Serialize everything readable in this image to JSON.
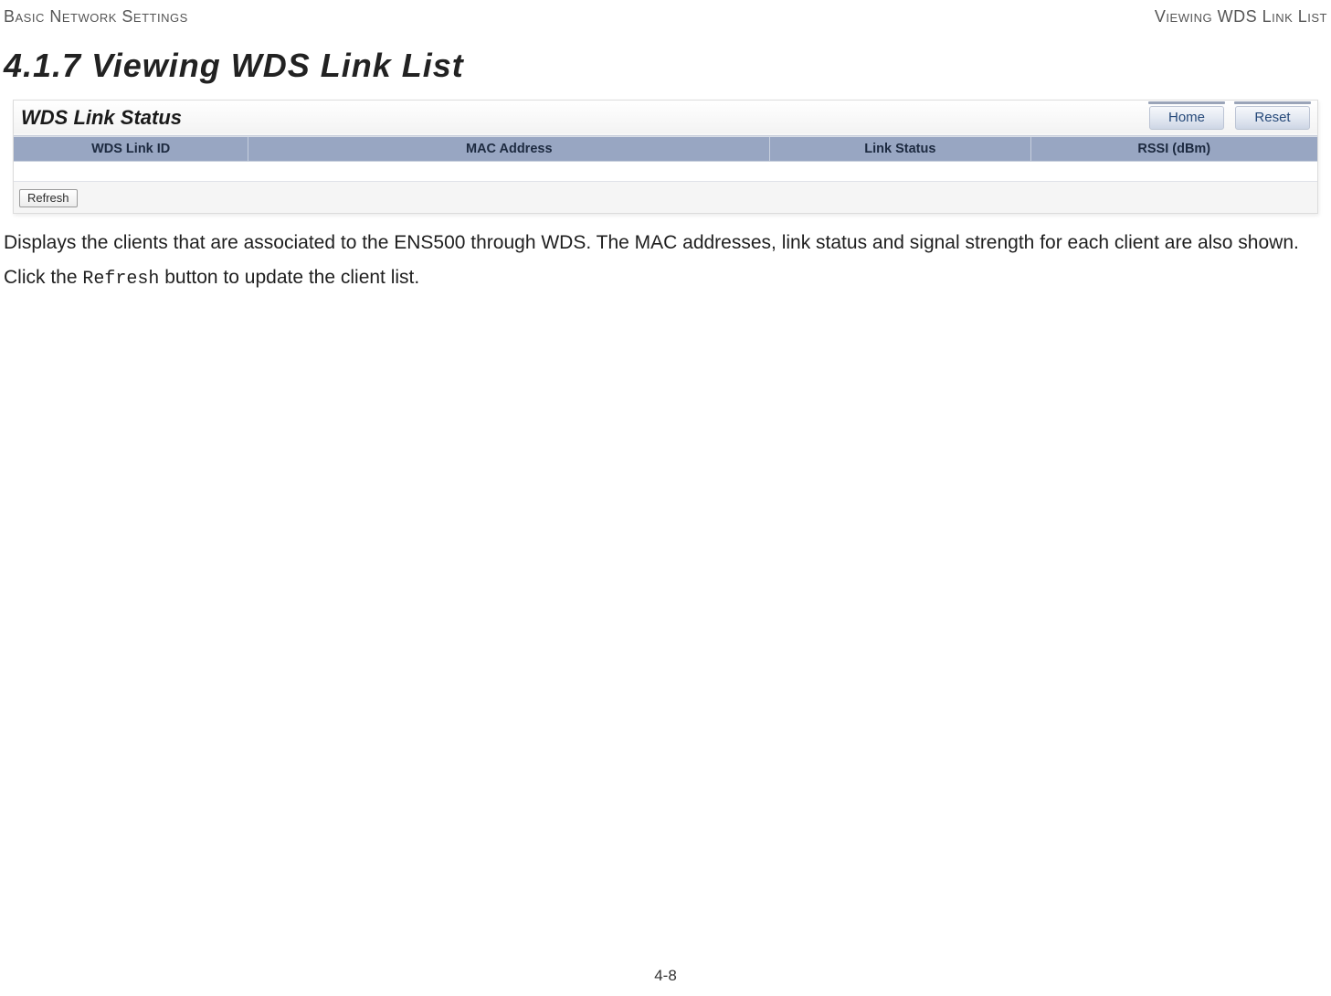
{
  "header": {
    "left": "Basic Network Settings",
    "right": "Viewing WDS Link List"
  },
  "section_title": "4.1.7 Viewing WDS Link List",
  "panel": {
    "title": "WDS Link Status",
    "buttons": {
      "home": "Home",
      "reset": "Reset"
    },
    "columns": {
      "wds_link_id": "WDS Link ID",
      "mac_address": "MAC Address",
      "link_status": "Link Status",
      "rssi": "RSSI (dBm)"
    },
    "refresh_label": "Refresh"
  },
  "description": {
    "para1": "Displays the clients that are associated to the ENS500 through WDS. The MAC addresses, link status and signal strength for each client are also shown.",
    "para2_prefix": "Click the ",
    "para2_code": "Refresh",
    "para2_suffix": " button to update the client list."
  },
  "page_number": "4-8"
}
